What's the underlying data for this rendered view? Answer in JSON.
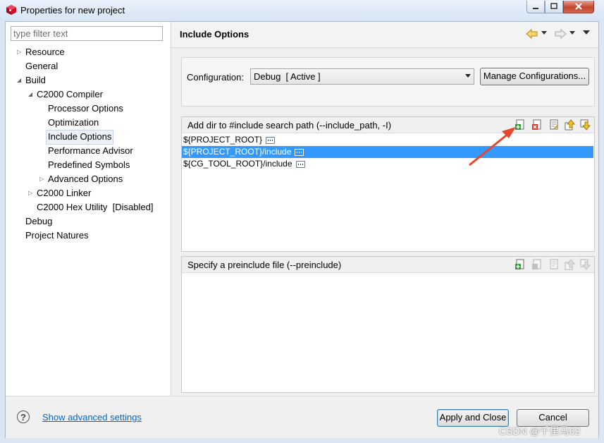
{
  "window": {
    "title": "Properties for new project"
  },
  "tree": {
    "filter_placeholder": "type filter text",
    "items": [
      {
        "label": "Resource"
      },
      {
        "label": "General"
      },
      {
        "label": "Build"
      },
      {
        "label": "C2000 Compiler"
      },
      {
        "label": "Processor Options"
      },
      {
        "label": "Optimization"
      },
      {
        "label": "Include Options"
      },
      {
        "label": "Performance Advisor"
      },
      {
        "label": "Predefined Symbols"
      },
      {
        "label": "Advanced Options"
      },
      {
        "label": "C2000 Linker"
      },
      {
        "label": "C2000 Hex Utility  [Disabled]"
      },
      {
        "label": "Debug"
      },
      {
        "label": "Project Natures"
      }
    ]
  },
  "page": {
    "title": "Include Options"
  },
  "configuration": {
    "label": "Configuration:",
    "selected": "Debug  [ Active ]",
    "manage_button": "Manage Configurations..."
  },
  "include_paths": {
    "title": "Add dir to #include search path (--include_path, -I)",
    "rows": [
      "${PROJECT_ROOT}",
      "${PROJECT_ROOT}/include",
      "${CG_TOOL_ROOT}/include"
    ]
  },
  "preinclude": {
    "title": "Specify a preinclude file (--preinclude)"
  },
  "footer": {
    "advanced_link": "Show advanced settings",
    "apply_close": "Apply and Close",
    "cancel": "Cancel"
  },
  "watermark": "CSDN @千里马02",
  "colors": {
    "selection": "#3399ff",
    "arrow": "#e8452c",
    "link": "#0066cc"
  }
}
